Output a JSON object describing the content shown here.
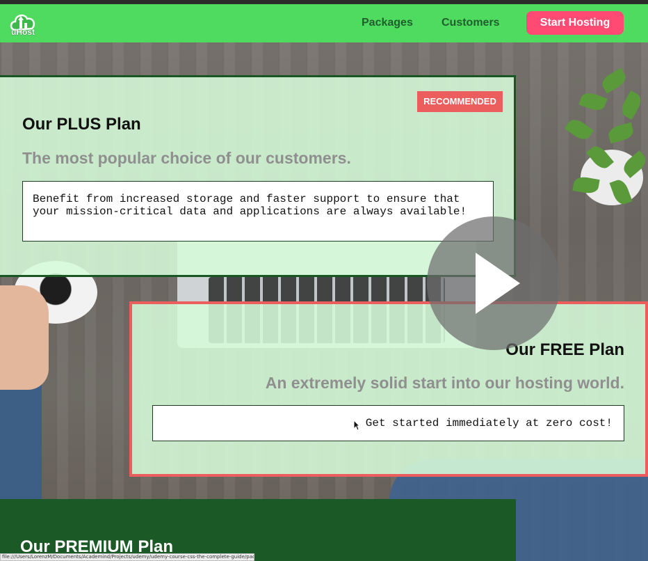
{
  "header": {
    "logo_text": "uHost",
    "nav": {
      "packages": "Packages",
      "customers": "Customers"
    },
    "cta_label": "Start Hosting"
  },
  "plans": {
    "plus": {
      "badge": "RECOMMENDED",
      "title": "Our PLUS Plan",
      "subtitle": "The most popular choice of our customers.",
      "description": "Benefit from increased storage and faster support to ensure that your mission-critical data and applications are always available!"
    },
    "free": {
      "title": "Our FREE Plan",
      "subtitle": "An extremely solid start into our hosting world.",
      "description": "Get started immediately at zero cost!"
    },
    "premium": {
      "title": "Our PREMIUM Plan"
    }
  },
  "status_bar": {
    "url": "file:///Users/LorenzM/Documents/Academind/Projects/udemy/udemy-course-css-the-complete-guide/packages/index.html#"
  },
  "colors": {
    "header_bg": "#4fdb60",
    "nav_text": "#1f5e2c",
    "cta_bg": "#ff4a74",
    "badge_bg": "#ec5e5e",
    "plus_border": "#1a5624",
    "free_border": "#ec5e5e",
    "premium_bg": "#1b5a27",
    "card_bg": "#d6fada"
  },
  "icons": {
    "logo": "cloud-upload-logo-icon",
    "play": "play-icon",
    "cursor": "mouse-cursor-icon"
  }
}
